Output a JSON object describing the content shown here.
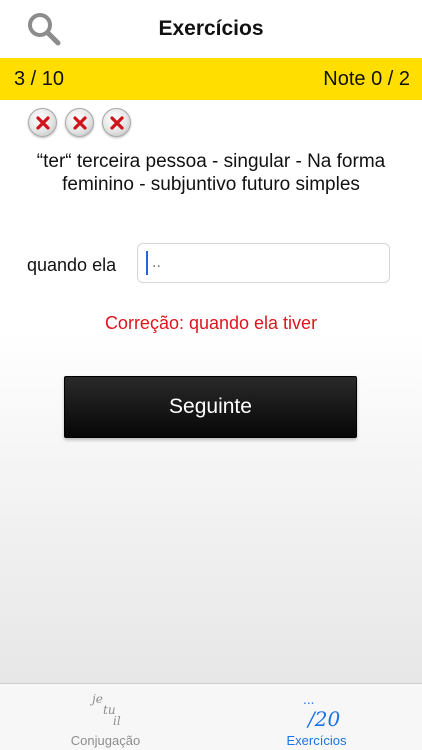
{
  "header": {
    "title": "Exercícios",
    "search_icon": "search-icon"
  },
  "progress": {
    "counter": "3 / 10",
    "score": "Note 0 / 2"
  },
  "results": {
    "marks": [
      "wrong",
      "wrong",
      "wrong"
    ],
    "mark_icon": "red-cross-icon"
  },
  "exercise": {
    "question": "“ter“ terceira pessoa - singular - Na forma feminino - subjuntivo futuro simples",
    "prefix_label": "quando ela",
    "input_value": "",
    "input_placeholder": "..",
    "correction": "Correção: quando ela tiver",
    "next_label": "Seguinte"
  },
  "tabbar": {
    "tabs": [
      {
        "label": "Conjugação",
        "icon": "je-tu-il-icon",
        "icon_text": [
          "je",
          "tu",
          "il"
        ],
        "active": false
      },
      {
        "label": "Exercícios",
        "icon": "score-20-icon",
        "icon_text": [
          "...",
          "/20"
        ],
        "active": true
      }
    ]
  },
  "colors": {
    "accent_yellow": "#ffde00",
    "error_red": "#e0141c",
    "active_tab": "#1a73e8",
    "inactive_tab": "#8e8e8e"
  }
}
